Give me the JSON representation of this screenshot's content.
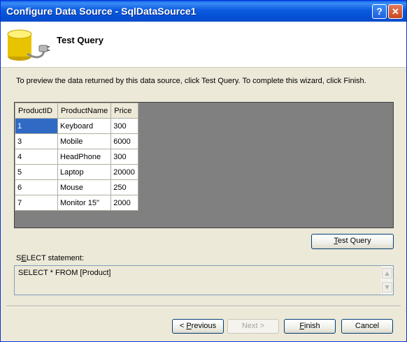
{
  "window": {
    "title": "Configure Data Source - SqlDataSource1"
  },
  "header": {
    "title": "Test Query",
    "icon": "database-plug-icon"
  },
  "instruction": "To preview the data returned by this data source, click Test Query. To complete this wizard, click Finish.",
  "results": {
    "columns": [
      "ProductID",
      "ProductName",
      "Price"
    ],
    "rows": [
      [
        "1",
        "Keyboard",
        "300"
      ],
      [
        "3",
        "Mobile",
        "6000"
      ],
      [
        "4",
        "HeadPhone",
        "300"
      ],
      [
        "5",
        "Laptop",
        "20000"
      ],
      [
        "6",
        "Mouse",
        "250"
      ],
      [
        "7",
        "Monitor 15\"",
        "2000"
      ]
    ]
  },
  "buttons": {
    "test_query_pre": "",
    "test_query_acc": "T",
    "test_query_post": "est Query",
    "previous_pre": "< ",
    "previous_acc": "P",
    "previous_post": "revious",
    "next": "Next >",
    "finish_acc": "F",
    "finish_post": "inish",
    "cancel": "Cancel"
  },
  "select_label_pre": "S",
  "select_label_acc": "E",
  "select_label_post": "LECT statement:",
  "sql": "SELECT * FROM [Product]",
  "colors": {
    "titlebar": "#0A5FE8",
    "dialog_bg": "#ECE9D8",
    "grid_bg": "#808080",
    "selection": "#316AC5"
  }
}
